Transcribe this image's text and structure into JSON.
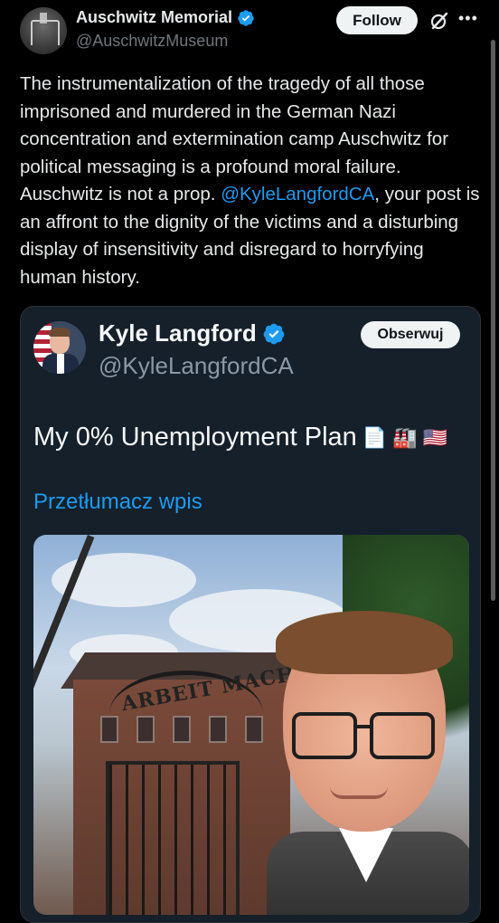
{
  "post": {
    "author": {
      "display_name": "Auschwitz Memorial",
      "handle": "@AuschwitzMuseum",
      "verified": true
    },
    "follow_label": "Follow",
    "text_before_mention": "The instrumentalization of the tragedy of all those imprisoned and murdered in the German Nazi concentration and extermination camp Auschwitz for political messaging is a profound moral failure. Auschwitz is not a prop. ",
    "mention": "@KyleLangfordCA",
    "text_after_mention": ", your post is an affront to the dignity of the victims and a disturbing display of insensitivity and disregard to horryfying human history.",
    "more_icon": "more-horizontal-icon",
    "grok_icon": "grok-icon"
  },
  "quote": {
    "author": {
      "display_name": "Kyle Langford",
      "handle": "@KyleLangfordCA",
      "verified": true
    },
    "follow_label": "Obserwuj",
    "text": "My 0% Unemployment Plan",
    "emojis": [
      "📄",
      "🏭",
      "🇺🇸"
    ],
    "translate_label": "Przetłumacz wpis",
    "image_sign_text": "ARBEIT MACHT"
  },
  "colors": {
    "background": "#000000",
    "quote_background": "#15202b",
    "link": "#1d9bf0",
    "verified": "#1d9bf0",
    "muted": "#71767b"
  }
}
